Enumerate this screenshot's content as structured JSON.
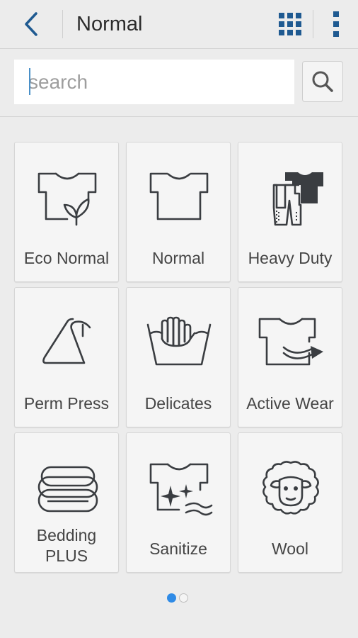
{
  "header": {
    "title": "Normal",
    "back_icon": "chevron-left-icon",
    "grid_icon": "grid-icon",
    "more_icon": "more-vert-icon"
  },
  "search": {
    "placeholder": "search",
    "value": ""
  },
  "cycles": [
    {
      "label": "Eco Normal",
      "icon": "shirt-leaf-icon"
    },
    {
      "label": "Normal",
      "icon": "shirt-icon"
    },
    {
      "label": "Heavy Duty",
      "icon": "heavy-clothes-icon"
    },
    {
      "label": "Perm Press",
      "icon": "hanger-icon"
    },
    {
      "label": "Delicates",
      "icon": "hand-wash-icon"
    },
    {
      "label": "Active Wear",
      "icon": "shirt-arrow-icon"
    },
    {
      "label": "Bedding PLUS",
      "icon": "bedding-icon"
    },
    {
      "label": "Sanitize",
      "icon": "shirt-sparkle-icon"
    },
    {
      "label": "Wool",
      "icon": "sheep-icon"
    }
  ],
  "pager": {
    "pages": 2,
    "current": 1
  },
  "colors": {
    "accent": "#1f5a91",
    "dot_active": "#2f8be6",
    "icon": "#3a3d41"
  }
}
